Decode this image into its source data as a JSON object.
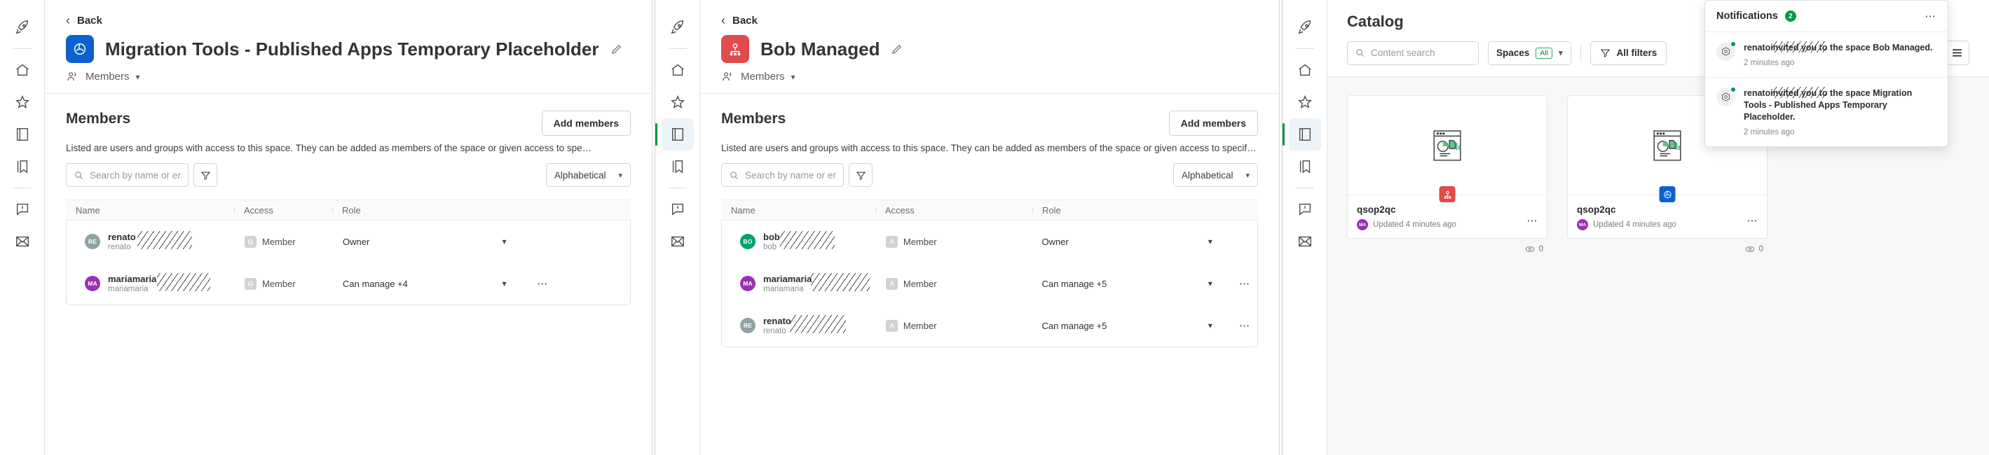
{
  "rail": {
    "icons": [
      {
        "name": "rocket-icon",
        "active": false
      },
      {
        "name": "home-icon",
        "active": false
      },
      {
        "name": "star-icon",
        "active": false
      },
      {
        "name": "catalog-icon",
        "active": false
      },
      {
        "name": "bookmark-icon",
        "active": false
      },
      {
        "name": "alerts-icon",
        "active": false
      },
      {
        "name": "mail-icon",
        "active": false
      }
    ]
  },
  "panel_a": {
    "back_label": "Back",
    "space_title": "Migration Tools - Published Apps Temporary Placeholder",
    "space_avatar_color": "#0b62ce",
    "space_avatar_icon": "space-shared-icon",
    "tab_label": "Members",
    "members": {
      "heading": "Members",
      "add_button": "Add members",
      "description": "Listed are users and groups with access to this space. They can be added as members of the space or given access to spe…",
      "search_placeholder": "Search by name or email",
      "search_value": "",
      "filter_icon": "filter-icon",
      "sort_label": "Alphabetical",
      "columns": [
        "Name",
        "Access",
        "Role",
        ""
      ],
      "rows": [
        {
          "initials": "RE",
          "avatar_color": "#8fa3a4",
          "name": "renato",
          "email": "renato",
          "name_redacted": true,
          "access": "Member",
          "role": "Owner",
          "has_menu": false
        },
        {
          "initials": "MA",
          "avatar_color": "#9b30b5",
          "name": "mariamaria",
          "email": "mariamaria",
          "name_redacted": true,
          "access": "Member",
          "role": "Can manage +4",
          "has_menu": true
        }
      ]
    }
  },
  "panel_b": {
    "back_label": "Back",
    "space_title": "Bob Managed",
    "space_avatar_color": "#e04b4b",
    "space_avatar_icon": "space-managed-icon",
    "tab_label": "Members",
    "members": {
      "heading": "Members",
      "add_button": "Add members",
      "description": "Listed are users and groups with access to this space. They can be added as members of the space or given access to specific content.",
      "search_placeholder": "Search by name or email",
      "search_value": "",
      "filter_icon": "filter-icon",
      "sort_label": "Alphabetical",
      "columns": [
        "Name",
        "Access",
        "Role",
        ""
      ],
      "rows": [
        {
          "initials": "BO",
          "avatar_color": "#00a368",
          "name": "bob",
          "email": "bob",
          "name_redacted": true,
          "access": "Member",
          "role": "Owner",
          "has_menu": false
        },
        {
          "initials": "MA",
          "avatar_color": "#9b30b5",
          "name": "mariamaria",
          "email": "mariamaria",
          "name_redacted": true,
          "access": "Member",
          "role": "Can manage +5",
          "has_menu": true
        },
        {
          "initials": "RE",
          "avatar_color": "#8fa3a4",
          "name": "renato",
          "email": "renato",
          "name_redacted": true,
          "access": "Member",
          "role": "Can manage +5",
          "has_menu": true
        }
      ]
    }
  },
  "panel_c": {
    "title": "Catalog",
    "search_placeholder": "Content search",
    "search_value": "",
    "spaces_label": "Spaces",
    "spaces_pill": "All",
    "filters_label": "All filters",
    "view_grid_active": true,
    "cards": [
      {
        "name": "qsop2qc",
        "updated": "Updated 4 minutes ago",
        "owner_initials": "MA",
        "views": "0",
        "badge_color": "#e04b4b",
        "badge_icon": "space-managed-icon"
      },
      {
        "name": "qsop2qc",
        "updated": "Updated 4 minutes ago",
        "owner_initials": "MA",
        "views": "0",
        "badge_color": "#0b62ce",
        "badge_icon": "space-shared-icon"
      }
    ],
    "notifications": {
      "title": "Notifications",
      "count": "2",
      "items": [
        {
          "actor": "renato",
          "text_after": "invited you to the space Bob Managed.",
          "time": "2 minutes ago",
          "unread": true
        },
        {
          "actor": "renato",
          "text_after": "invited you to the space Migration Tools - Published Apps Temporary Placeholder.",
          "time": "2 minutes ago",
          "unread": true
        }
      ]
    }
  }
}
